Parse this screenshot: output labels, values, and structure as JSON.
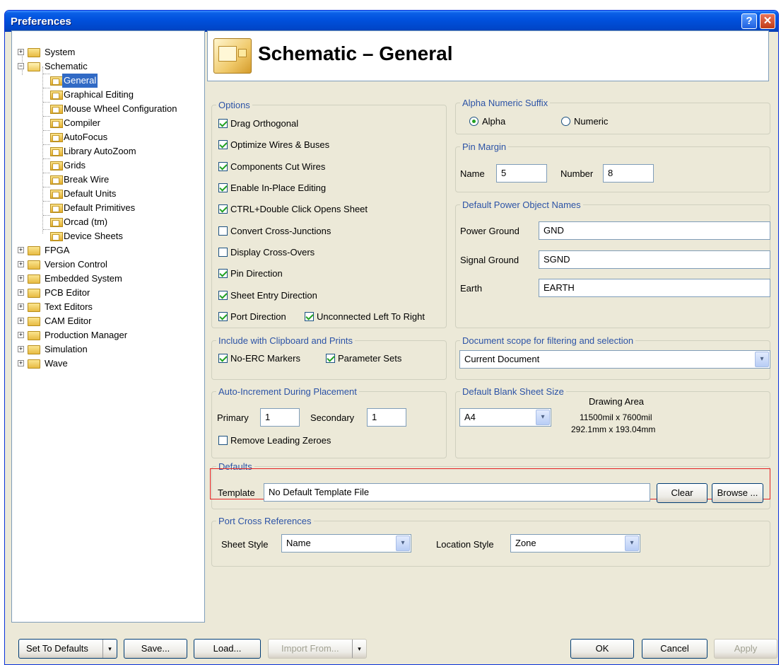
{
  "window": {
    "title": "Preferences",
    "help_label": "?",
    "close_label": "✕"
  },
  "tree": {
    "items": [
      {
        "label": "System",
        "expander": "+"
      },
      {
        "label": "Schematic",
        "expander": "−"
      },
      {
        "label": "FPGA",
        "expander": "+"
      },
      {
        "label": "Version Control",
        "expander": "+"
      },
      {
        "label": "Embedded System",
        "expander": "+"
      },
      {
        "label": "PCB Editor",
        "expander": "+"
      },
      {
        "label": "Text Editors",
        "expander": "+"
      },
      {
        "label": "CAM Editor",
        "expander": "+"
      },
      {
        "label": "Production Manager",
        "expander": "+"
      },
      {
        "label": "Simulation",
        "expander": "+"
      },
      {
        "label": "Wave",
        "expander": "+"
      }
    ],
    "schematic_children": [
      "General",
      "Graphical Editing",
      "Mouse Wheel Configuration",
      "Compiler",
      "AutoFocus",
      "Library AutoZoom",
      "Grids",
      "Break Wire",
      "Default Units",
      "Default Primitives",
      "Orcad (tm)",
      "Device Sheets"
    ],
    "selected": "General"
  },
  "header": {
    "title": "Schematic – General"
  },
  "options": {
    "legend": "Options",
    "drag_orthogonal": "Drag Orthogonal",
    "optimize_wires": "Optimize Wires & Buses",
    "components_cut_wires": "Components Cut Wires",
    "enable_inplace": "Enable In-Place Editing",
    "ctrl_double_click": "CTRL+Double Click Opens Sheet",
    "convert_cross_junctions": "Convert Cross-Junctions",
    "display_cross_overs": "Display Cross-Overs",
    "pin_direction": "Pin Direction",
    "sheet_entry_direction": "Sheet Entry Direction",
    "port_direction": "Port Direction",
    "unconnected_left_to_right": "Unconnected Left To Right"
  },
  "alpha_numeric": {
    "legend": "Alpha Numeric Suffix",
    "alpha": "Alpha",
    "numeric": "Numeric",
    "selected": "Alpha"
  },
  "pin_margin": {
    "legend": "Pin Margin",
    "name_label": "Name",
    "name_value": "5",
    "number_label": "Number",
    "number_value": "8"
  },
  "power_names": {
    "legend": "Default Power Object Names",
    "power_ground_label": "Power Ground",
    "power_ground_value": "GND",
    "signal_ground_label": "Signal Ground",
    "signal_ground_value": "SGND",
    "earth_label": "Earth",
    "earth_value": "EARTH"
  },
  "clipboard": {
    "legend": "Include with Clipboard and Prints",
    "no_erc": "No-ERC Markers",
    "parameter_sets": "Parameter Sets"
  },
  "doc_scope": {
    "legend": "Document scope for filtering and selection",
    "value": "Current Document"
  },
  "auto_increment": {
    "legend": "Auto-Increment During Placement",
    "primary_label": "Primary",
    "primary_value": "1",
    "secondary_label": "Secondary",
    "secondary_value": "1",
    "remove_leading_zeroes": "Remove Leading Zeroes"
  },
  "blank_sheet": {
    "legend": "Default Blank Sheet Size",
    "value": "A4",
    "drawing_area_title": "Drawing Area",
    "mil_size": "11500mil x 7600mil",
    "mm_size": "292.1mm x 193.04mm"
  },
  "defaults": {
    "legend": "Defaults",
    "template_label": "Template",
    "template_value": "No Default Template File",
    "clear": "Clear",
    "browse": "Browse ..."
  },
  "port_cross": {
    "legend": "Port Cross References",
    "sheet_style_label": "Sheet Style",
    "sheet_style_value": "Name",
    "location_style_label": "Location Style",
    "location_style_value": "Zone"
  },
  "footer": {
    "set_to_defaults": "Set To Defaults",
    "save": "Save...",
    "load": "Load...",
    "import_from": "Import From...",
    "ok": "OK",
    "cancel": "Cancel",
    "apply": "Apply"
  },
  "icons": {
    "dropdown": "▾"
  }
}
